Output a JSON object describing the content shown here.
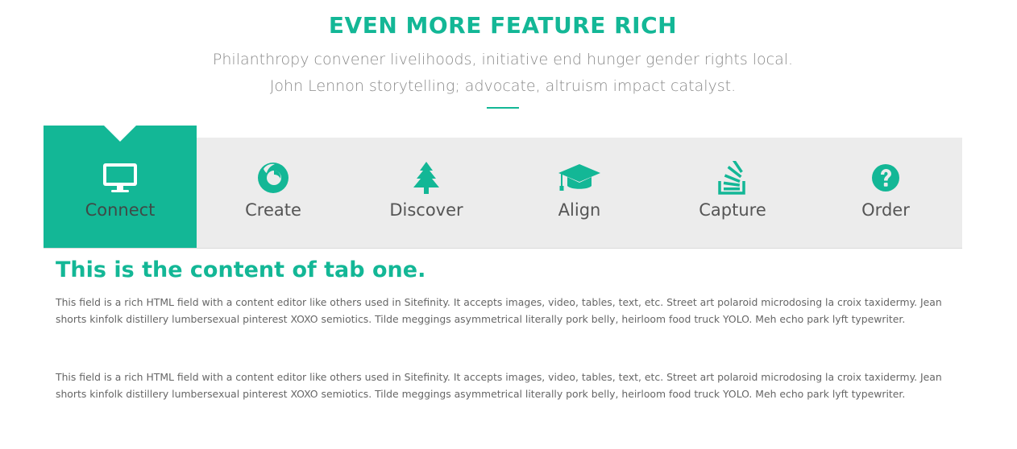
{
  "section": {
    "title": "EVEN MORE FEATURE RICH",
    "subtitle": "Philanthropy convener livelihoods, initiative end hunger gender rights local. John Lennon storytelling; advocate, altruism impact catalyst."
  },
  "tabs": [
    {
      "label": "Connect",
      "icon": "desktop-icon",
      "active": true
    },
    {
      "label": "Create",
      "icon": "firefox-icon",
      "active": false
    },
    {
      "label": "Discover",
      "icon": "tree-icon",
      "active": false
    },
    {
      "label": "Align",
      "icon": "graduation-cap-icon",
      "active": false
    },
    {
      "label": "Capture",
      "icon": "stack-overflow-icon",
      "active": false
    },
    {
      "label": "Order",
      "icon": "question-circle-icon",
      "active": false
    }
  ],
  "content": {
    "title": "This is the content of tab one.",
    "paragraphs": [
      "This field is a rich HTML field with a content editor like others used in Sitefinity. It accepts images, video, tables, text, etc. Street art polaroid microdosing la croix taxidermy. Jean shorts kinfolk distillery lumbersexual pinterest XOXO semiotics. Tilde meggings asymmetrical literally pork belly, heirloom food truck YOLO. Meh echo park lyft typewriter.",
      "This field is a rich HTML field with a content editor like others used in Sitefinity. It accepts images, video, tables, text, etc. Street art polaroid microdosing la croix taxidermy. Jean shorts kinfolk distillery lumbersexual pinterest XOXO semiotics. Tilde meggings asymmetrical literally pork belly, heirloom food truck YOLO. Meh echo park lyft typewriter."
    ]
  },
  "colors": {
    "accent": "#13b796",
    "tabbar_bg": "#ececec",
    "text_muted": "#8a8a8a"
  }
}
